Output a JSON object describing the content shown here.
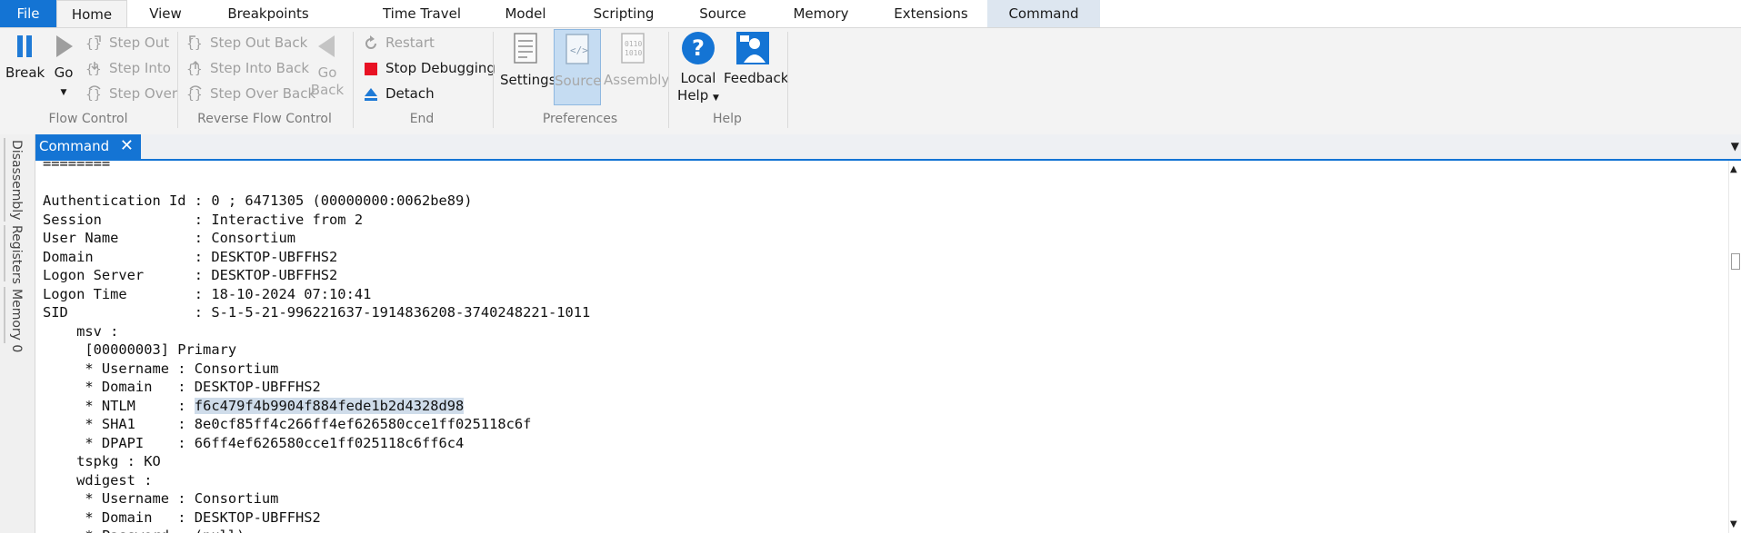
{
  "tabs": {
    "file": "File",
    "home": "Home",
    "view": "View",
    "breakpoints": "Breakpoints",
    "time_travel": "Time Travel",
    "model": "Model",
    "scripting": "Scripting",
    "source": "Source",
    "memory": "Memory",
    "extensions": "Extensions",
    "command": "Command"
  },
  "ribbon": {
    "flow_control": {
      "label": "Flow Control",
      "break": "Break",
      "go": "Go",
      "step_out": "Step Out",
      "step_into": "Step Into",
      "step_over": "Step Over"
    },
    "reverse_flow_control": {
      "label": "Reverse Flow Control",
      "step_out_back": "Step Out Back",
      "step_into_back": "Step Into Back",
      "step_over_back": "Step Over Back",
      "go_back_line1": "Go",
      "go_back_line2": "Back"
    },
    "end": {
      "label": "End",
      "restart": "Restart",
      "stop_debugging": "Stop Debugging",
      "detach": "Detach"
    },
    "preferences": {
      "label": "Preferences",
      "settings": "Settings",
      "source": "Source",
      "assembly": "Assembly"
    },
    "help": {
      "label": "Help",
      "local_help_line1": "Local",
      "local_help_line2": "Help",
      "feedback": "Feedback"
    }
  },
  "left_panel": {
    "disassembly": "Disassembly",
    "registers": "Registers",
    "memory0": "Memory 0"
  },
  "doc_tab": {
    "title": "Command",
    "close_glyph": "✕"
  },
  "console": {
    "lines_before": "========\n\nAuthentication Id : 0 ; 6471305 (00000000:0062be89)\nSession           : Interactive from 2\nUser Name         : Consortium\nDomain            : DESKTOP-UBFFHS2\nLogon Server      : DESKTOP-UBFFHS2\nLogon Time        : 18-10-2024 07:10:41\nSID               : S-1-5-21-996221637-1914836208-3740248221-1011\n    msv :\n     [00000003] Primary\n     * Username : Consortium\n     * Domain   : DESKTOP-UBFFHS2\n     * NTLM     : ",
    "selected": "f6c479f4b9904f884fede1b2d4328d98",
    "lines_after": "\n     * SHA1     : 8e0cf85ff4c266ff4ef626580cce1ff025118c6f\n     * DPAPI    : 66ff4ef626580cce1ff025118c6ff6c4\n    tspkg : KO\n    wdigest :\n     * Username : Consortium\n     * Domain   : DESKTOP-UBFFHS2\n     * Password : (null)"
  },
  "colors": {
    "accent": "#1474d4",
    "ribbon_bg": "#f3f3f3",
    "selection": "#cfdcea",
    "stop_red": "#e81123"
  }
}
